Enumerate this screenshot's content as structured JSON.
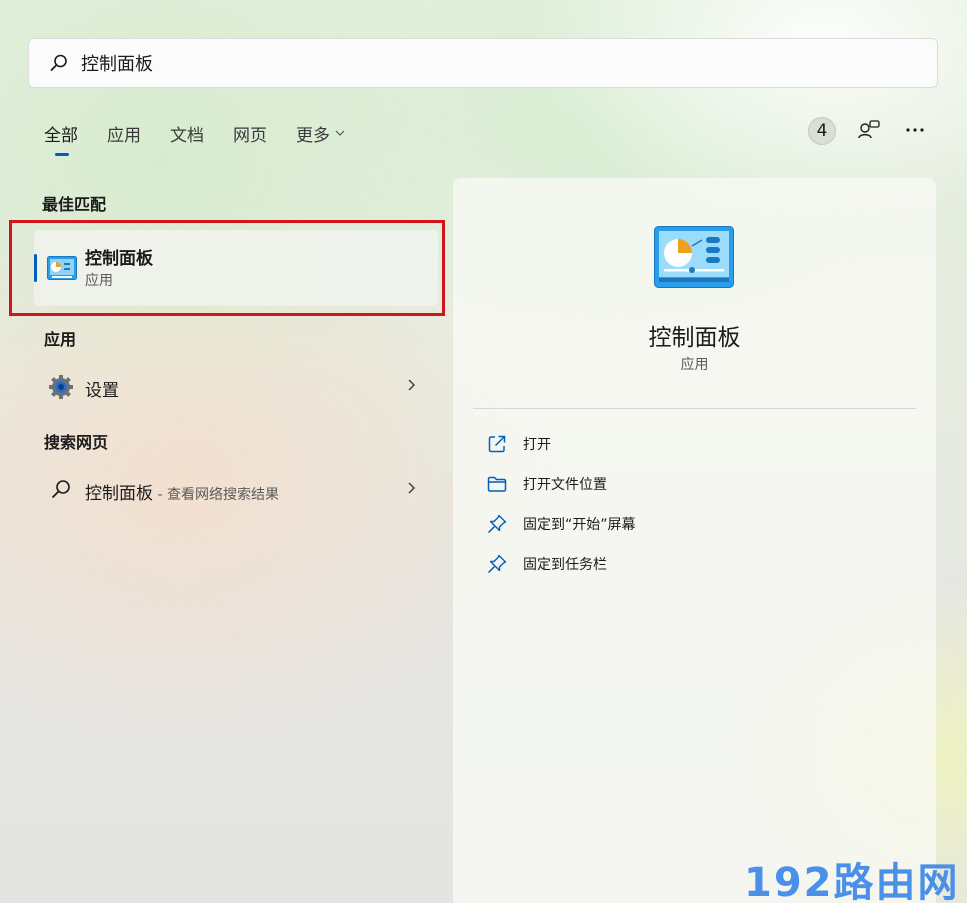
{
  "search": {
    "value": "控制面板"
  },
  "tabs": [
    {
      "label": "全部",
      "active": true
    },
    {
      "label": "应用"
    },
    {
      "label": "文档"
    },
    {
      "label": "网页"
    },
    {
      "label": "更多"
    }
  ],
  "toolbar": {
    "count": "4"
  },
  "best_match": {
    "section_title": "最佳匹配",
    "title": "控制面板",
    "subtitle": "应用"
  },
  "apps": {
    "section_title": "应用",
    "items": [
      {
        "label": "设置"
      }
    ]
  },
  "web": {
    "section_title": "搜索网页",
    "items": [
      {
        "label": "控制面板",
        "hint": " - 查看网络搜索结果"
      }
    ]
  },
  "detail": {
    "title": "控制面板",
    "subtitle": "应用",
    "actions": [
      {
        "label": "打开",
        "icon": "open-external-icon"
      },
      {
        "label": "打开文件位置",
        "icon": "folder-icon"
      },
      {
        "label": "固定到“开始”屏幕",
        "icon": "pin-icon"
      },
      {
        "label": "固定到任务栏",
        "icon": "pin-icon"
      }
    ]
  },
  "watermark": "192路由网",
  "colors": {
    "accent": "#005fb8",
    "highlight": "#d0161a",
    "watermark": "#4a8fe8"
  }
}
